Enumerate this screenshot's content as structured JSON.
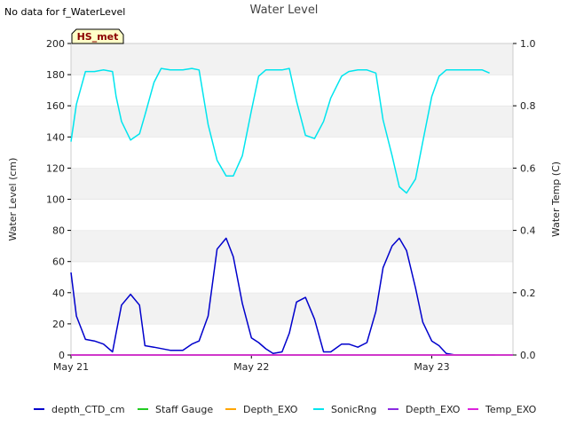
{
  "note": "No data for f_WaterLevel",
  "badge": "HS_met",
  "chart_data": {
    "type": "line",
    "title": "Water Level",
    "ylabel": "Water Level (cm)",
    "y2label": "Water Temp (C)",
    "ylim": [
      0,
      200
    ],
    "y2lim": [
      0,
      1.0
    ],
    "yticks": [
      0,
      20,
      40,
      60,
      80,
      100,
      120,
      140,
      160,
      180,
      200
    ],
    "y2ticks": [
      "0.0",
      "0.2",
      "0.4",
      "0.6",
      "0.8",
      "1.0"
    ],
    "xlim_days": [
      0,
      2.45
    ],
    "xticks": [
      {
        "label": "May 21",
        "day": 0
      },
      {
        "label": "May 22",
        "day": 1
      },
      {
        "label": "May 23",
        "day": 2
      }
    ],
    "grid": true,
    "legend_position": "bottom",
    "series": [
      {
        "name": "depth_CTD_cm",
        "color": "#0000cc",
        "axis": "left",
        "x": [
          0.0,
          0.03,
          0.08,
          0.13,
          0.18,
          0.23,
          0.25,
          0.28,
          0.33,
          0.38,
          0.41,
          0.46,
          0.55,
          0.62,
          0.67,
          0.71,
          0.76,
          0.81,
          0.86,
          0.9,
          0.95,
          1.0,
          1.04,
          1.08,
          1.12,
          1.17,
          1.21,
          1.25,
          1.3,
          1.35,
          1.4,
          1.44,
          1.5,
          1.54,
          1.59,
          1.64,
          1.69,
          1.73,
          1.78,
          1.82,
          1.86,
          1.91,
          1.95,
          2.0,
          2.04,
          2.08,
          2.13,
          2.18,
          2.23,
          2.28,
          2.32,
          2.35
        ],
        "y": [
          53,
          25,
          10,
          9,
          7,
          2,
          14,
          32,
          39,
          32,
          6,
          5,
          3,
          3,
          7,
          9,
          25,
          68,
          75,
          63,
          33,
          11,
          8,
          4,
          1,
          2,
          14,
          34,
          37,
          23,
          2,
          2,
          7,
          7,
          5,
          8,
          28,
          56,
          70,
          75,
          67,
          43,
          21,
          9,
          6,
          1,
          0,
          0,
          0,
          0,
          0,
          0
        ]
      },
      {
        "name": "Staff Gauge",
        "color": "#22cc22",
        "axis": "left",
        "x": [
          0,
          2.45
        ],
        "y": [
          0,
          0
        ]
      },
      {
        "name": "Depth_EXO",
        "color": "#ffa500",
        "axis": "left",
        "x": [
          0,
          2.45
        ],
        "y": [
          0,
          0
        ]
      },
      {
        "name": "SonicRng",
        "color": "#00e5ee",
        "axis": "left",
        "x": [
          0.0,
          0.03,
          0.08,
          0.13,
          0.18,
          0.23,
          0.25,
          0.28,
          0.33,
          0.38,
          0.41,
          0.46,
          0.5,
          0.55,
          0.62,
          0.67,
          0.71,
          0.76,
          0.81,
          0.86,
          0.9,
          0.95,
          1.0,
          1.04,
          1.08,
          1.12,
          1.17,
          1.21,
          1.25,
          1.3,
          1.35,
          1.4,
          1.44,
          1.5,
          1.54,
          1.59,
          1.64,
          1.69,
          1.73,
          1.78,
          1.82,
          1.86,
          1.91,
          1.95,
          2.0,
          2.04,
          2.08,
          2.13,
          2.18,
          2.23,
          2.28,
          2.32
        ],
        "y": [
          137,
          161,
          182,
          182,
          183,
          182,
          166,
          150,
          138,
          142,
          154,
          175,
          184,
          183,
          183,
          184,
          183,
          148,
          125,
          115,
          115,
          128,
          157,
          179,
          183,
          183,
          183,
          184,
          163,
          141,
          139,
          150,
          165,
          179,
          182,
          183,
          183,
          181,
          151,
          128,
          108,
          104,
          113,
          137,
          166,
          179,
          183,
          183,
          183,
          183,
          183,
          181
        ]
      },
      {
        "name": "Depth_EXO",
        "color": "#8a2be2",
        "axis": "right",
        "x": [
          0,
          2.45
        ],
        "y": [
          0,
          0
        ]
      },
      {
        "name": "Temp_EXO",
        "color": "#dd22dd",
        "axis": "right",
        "x": [
          0,
          2.45
        ],
        "y": [
          0,
          0
        ]
      }
    ]
  }
}
